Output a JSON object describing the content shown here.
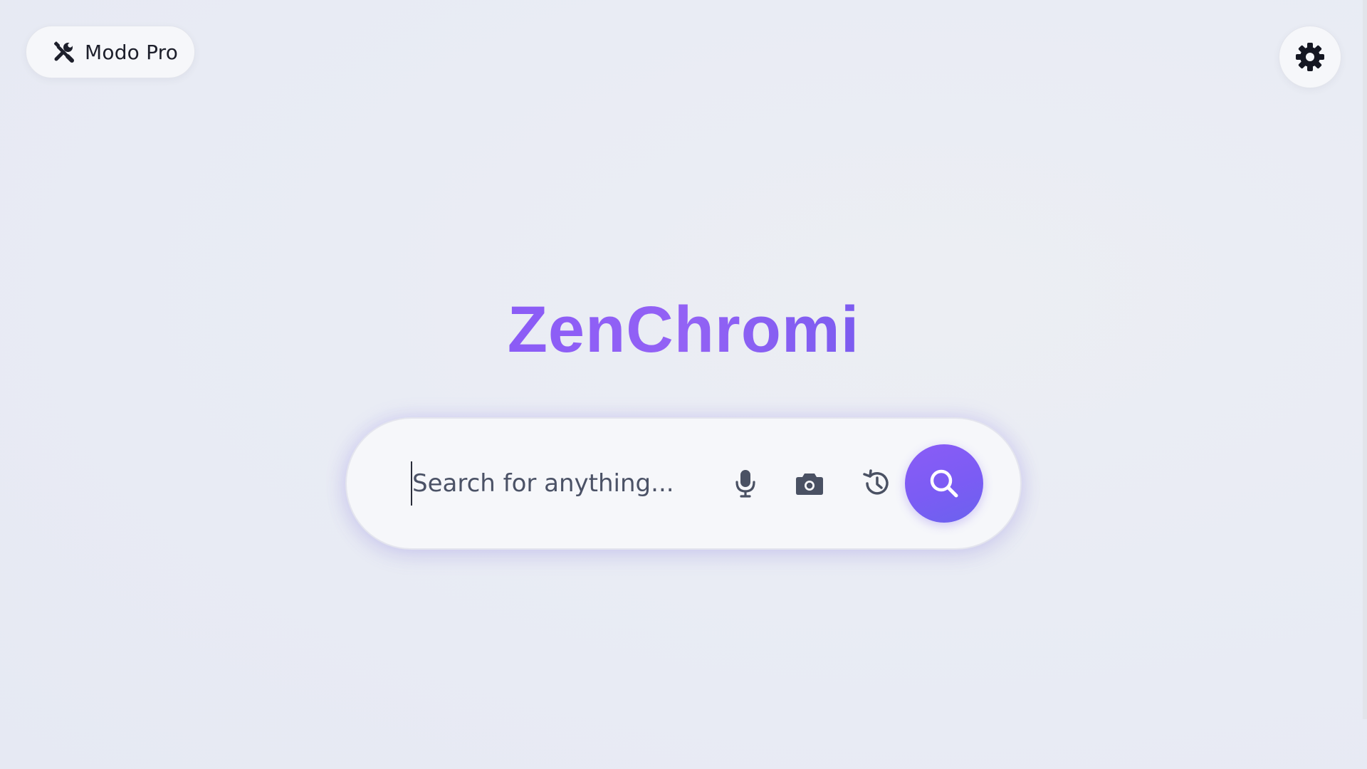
{
  "header": {
    "pro_mode_label": "Modo Pro",
    "pro_mode_icon": "tools-icon",
    "settings_icon": "gear-icon"
  },
  "logo": {
    "text": "ZenChromi",
    "gradient_colors": [
      "#8b5cf6",
      "#7c5cf0"
    ]
  },
  "search": {
    "placeholder": "Search for anything...",
    "value": "",
    "tools": [
      {
        "name": "microphone-icon"
      },
      {
        "name": "camera-icon"
      },
      {
        "name": "history-icon"
      }
    ],
    "submit_icon": "search-icon",
    "accent_color": "#8a5cf6"
  }
}
